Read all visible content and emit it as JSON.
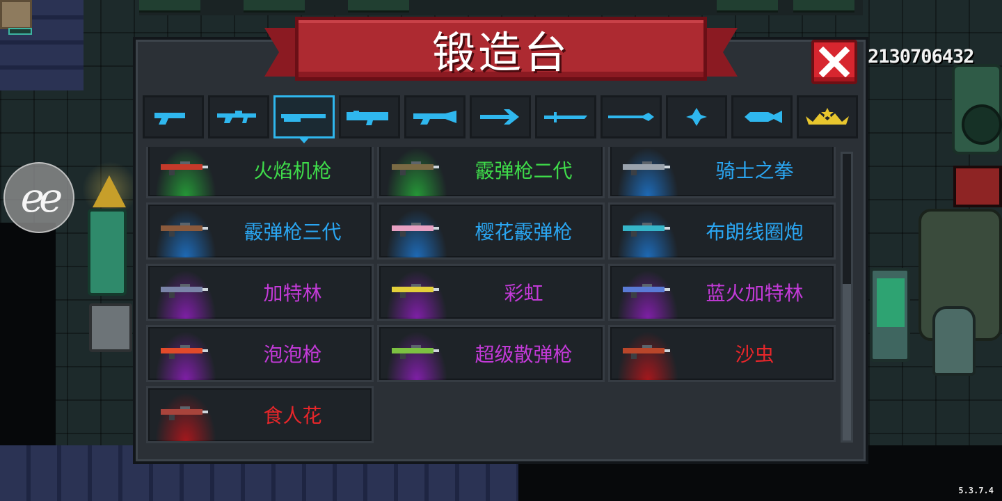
{
  "title": "锻造台",
  "score": "2130706432",
  "version": "5.3.7.4",
  "overlay_button_label": "ee",
  "colors": {
    "rarity_green": "#3fdc4a",
    "rarity_blue": "#2aa6f2",
    "rarity_purple": "#c33ad8",
    "rarity_red": "#e8262a",
    "tab_accent": "#2fb7ee",
    "banner_red": "#ad2a31"
  },
  "tabs": [
    {
      "icon": "pistol-icon",
      "active": false
    },
    {
      "icon": "rifle-icon",
      "active": false
    },
    {
      "icon": "shotgun-icon",
      "active": true
    },
    {
      "icon": "launcher-icon",
      "active": false
    },
    {
      "icon": "laser-gun-icon",
      "active": false
    },
    {
      "icon": "crossbow-icon",
      "active": false
    },
    {
      "icon": "sword-icon",
      "active": false
    },
    {
      "icon": "spear-icon",
      "active": false
    },
    {
      "icon": "shuriken-icon",
      "active": false
    },
    {
      "icon": "fish-icon",
      "active": false
    },
    {
      "icon": "crown-stars-icon",
      "active": false
    }
  ],
  "weapons": [
    {
      "name": "火焰机枪",
      "rarity": "green",
      "icon": "flame-machine-gun-icon"
    },
    {
      "name": "霰弹枪二代",
      "rarity": "green",
      "icon": "shotgun-mk2-icon"
    },
    {
      "name": "骑士之拳",
      "rarity": "blue",
      "icon": "knight-fist-icon"
    },
    {
      "name": "霰弹枪三代",
      "rarity": "blue",
      "icon": "shotgun-mk3-icon"
    },
    {
      "name": "樱花霰弹枪",
      "rarity": "blue",
      "icon": "sakura-shotgun-icon"
    },
    {
      "name": "布朗线圈炮",
      "rarity": "blue",
      "icon": "brown-coilgun-icon"
    },
    {
      "name": "加特林",
      "rarity": "purple",
      "icon": "gatling-icon"
    },
    {
      "name": "彩虹",
      "rarity": "purple",
      "icon": "rainbow-gun-icon"
    },
    {
      "name": "蓝火加特林",
      "rarity": "purple",
      "icon": "blue-fire-gatling-icon"
    },
    {
      "name": "泡泡枪",
      "rarity": "purple",
      "icon": "bubble-gun-icon"
    },
    {
      "name": "超级散弹枪",
      "rarity": "purple",
      "icon": "super-shotgun-icon"
    },
    {
      "name": "沙虫",
      "rarity": "red",
      "icon": "sandworm-icon"
    },
    {
      "name": "食人花",
      "rarity": "red",
      "icon": "piranha-plant-icon"
    }
  ]
}
